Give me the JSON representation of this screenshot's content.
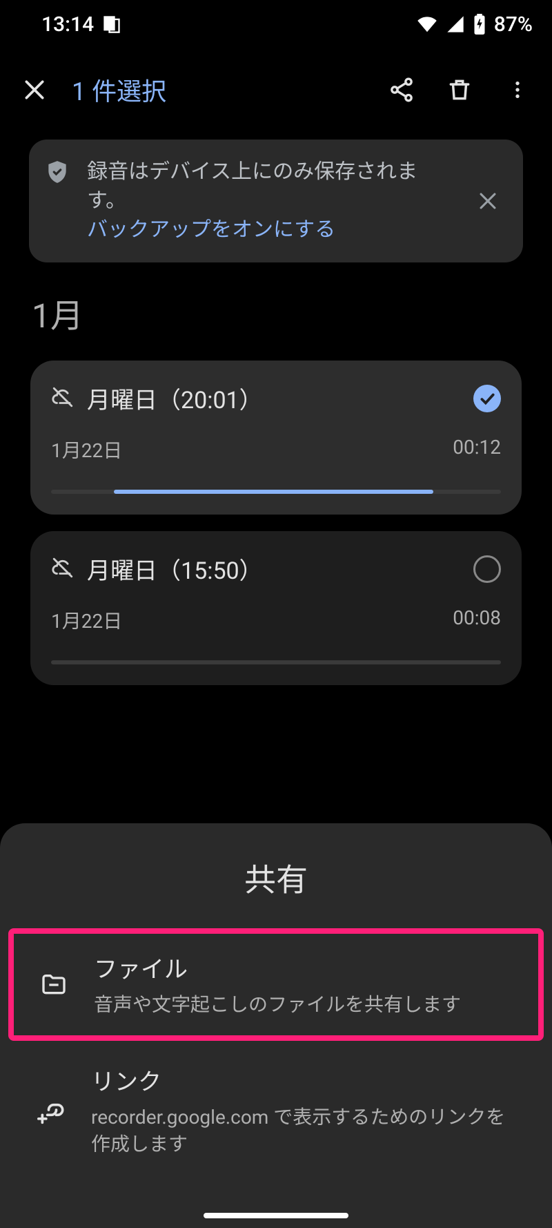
{
  "status": {
    "time": "13:14",
    "battery": "87%"
  },
  "topbar": {
    "selection_title": "1 件選択"
  },
  "banner": {
    "message": "録音はデバイス上にのみ保存されます。",
    "link": "バックアップをオンにする"
  },
  "month_label": "1月",
  "recordings": [
    {
      "title": "月曜日（20:01）",
      "date": "1月22日",
      "duration": "00:12",
      "selected": true,
      "progress_left_pct": 14,
      "progress_width_pct": 71
    },
    {
      "title": "月曜日（15:50）",
      "date": "1月22日",
      "duration": "00:08",
      "selected": false,
      "progress_left_pct": 0,
      "progress_width_pct": 0
    }
  ],
  "sheet": {
    "title": "共有",
    "items": [
      {
        "title": "ファイル",
        "subtitle": "音声や文字起こしのファイルを共有します",
        "highlight": true,
        "icon": "folder"
      },
      {
        "title": "リンク",
        "subtitle": "recorder.google.com で表示するためのリンクを作成します",
        "highlight": false,
        "icon": "link-add"
      }
    ]
  }
}
